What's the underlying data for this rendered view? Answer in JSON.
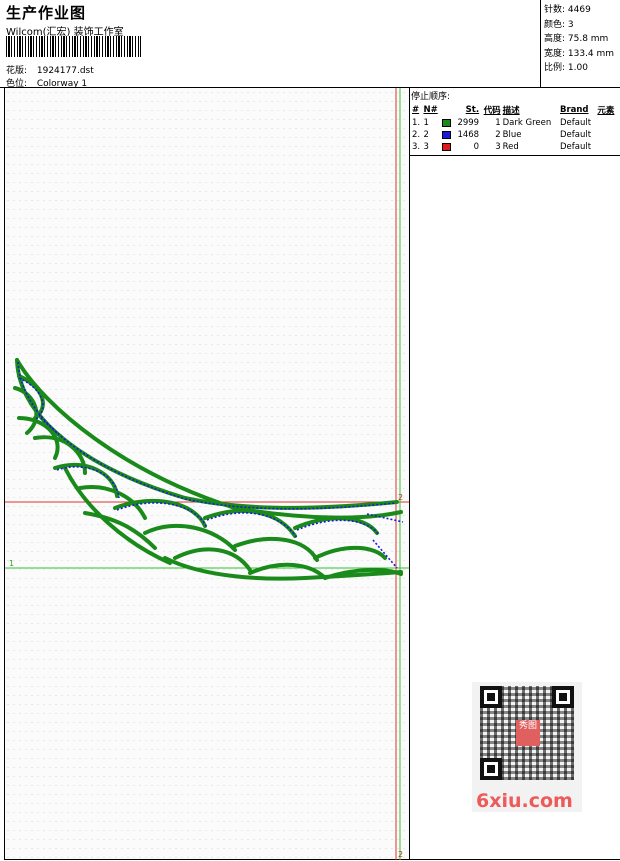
{
  "header": {
    "title": "生产作业图",
    "company": "Wilcom(汇宏) 装饰工作室",
    "design_label": "花版:",
    "design_value": "1924177.dst",
    "colorway_label": "色位:",
    "colorway_value": "Colorway 1"
  },
  "info": {
    "stitches": "针数: 4469",
    "colors": "颜色: 3",
    "height": "高度: 75.8 mm",
    "width": "宽度: 133.4 mm",
    "scale": "比例: 1.00"
  },
  "panel": {
    "title": "停止顺序:",
    "columns": [
      "#",
      "N#",
      "St.",
      "代码",
      "描述",
      "Brand",
      "元素"
    ],
    "rows": [
      {
        "idx": "1.",
        "n": "1",
        "color": "#1a8a1a",
        "st": "2999",
        "code": "1",
        "desc": "Dark Green",
        "brand": "Default"
      },
      {
        "idx": "2.",
        "n": "2",
        "color": "#1a1ad8",
        "st": "1468",
        "code": "2",
        "desc": "Blue",
        "brand": "Default"
      },
      {
        "idx": "3.",
        "n": "3",
        "color": "#e01a1a",
        "st": "0",
        "code": "3",
        "desc": "Red",
        "brand": "Default"
      }
    ]
  },
  "canvas": {
    "guide_label_left": "1",
    "guide_label_top": "2",
    "guide_label_bottom": "2"
  },
  "watermark": {
    "text": "6xiu.com",
    "seal": "秀图"
  }
}
